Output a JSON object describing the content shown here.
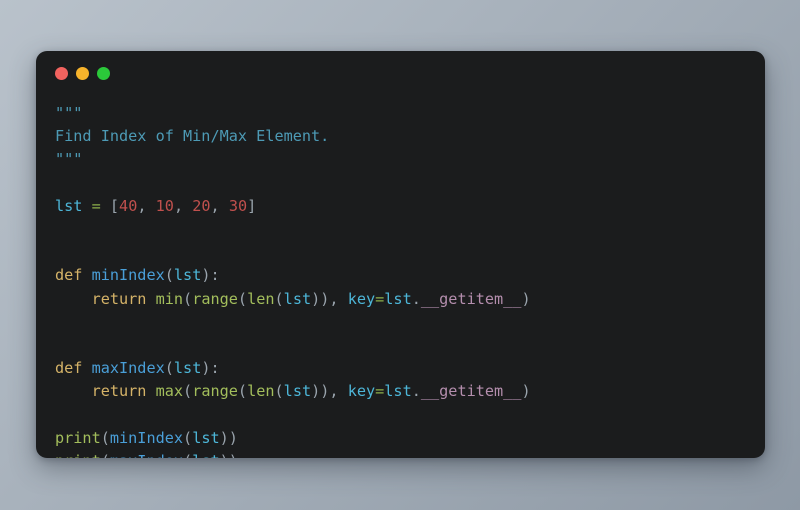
{
  "window": {
    "name": "code-snippet-window",
    "background": "#1b1c1d",
    "traffic_lights": [
      {
        "name": "close-button",
        "label": "close",
        "color": "#f2635f"
      },
      {
        "name": "minimize-button",
        "label": "minimize",
        "color": "#f7b32b"
      },
      {
        "name": "maximize-button",
        "label": "maximize",
        "color": "#2bc93a"
      }
    ]
  },
  "page": {
    "background_start": "#b9c2cb",
    "background_end": "#8e99a5"
  },
  "editor": {
    "language": "python",
    "font_size_px": 15,
    "plain_text": "\"\"\"\nFind Index of Min/Max Element.\n\"\"\"\n\nlst = [40, 10, 20, 30]\n\n\ndef minIndex(lst):\n    return min(range(len(lst)), key=lst.__getitem__)\n\n\ndef maxIndex(lst):\n    return max(range(len(lst)), key=lst.__getitem__)\n\nprint(minIndex(lst))\nprint(maxIndex(lst))",
    "palette": {
      "default": "#9aa4ad",
      "docstring": "#4d9ab5",
      "keyword": "#d5b368",
      "function": "#4a9fd8",
      "variable": "#4db6d8",
      "builtin": "#a3be5c",
      "operator": "#8cae4a",
      "number": "#c0504d",
      "dunder": "#b48ead",
      "punct": "#9aa4ad"
    },
    "lines": [
      {
        "tokens": [
          {
            "t": "\"\"\"",
            "c": "docstring"
          }
        ]
      },
      {
        "tokens": [
          {
            "t": "Find Index of Min/Max Element.",
            "c": "docstring"
          }
        ]
      },
      {
        "tokens": [
          {
            "t": "\"\"\"",
            "c": "docstring"
          }
        ]
      },
      {
        "tokens": []
      },
      {
        "tokens": [
          {
            "t": "lst",
            "c": "variable"
          },
          {
            "t": " ",
            "c": "punct"
          },
          {
            "t": "=",
            "c": "operator"
          },
          {
            "t": " [",
            "c": "punct"
          },
          {
            "t": "40",
            "c": "number"
          },
          {
            "t": ", ",
            "c": "punct"
          },
          {
            "t": "10",
            "c": "number"
          },
          {
            "t": ", ",
            "c": "punct"
          },
          {
            "t": "20",
            "c": "number"
          },
          {
            "t": ", ",
            "c": "punct"
          },
          {
            "t": "30",
            "c": "number"
          },
          {
            "t": "]",
            "c": "punct"
          }
        ]
      },
      {
        "tokens": []
      },
      {
        "tokens": []
      },
      {
        "tokens": [
          {
            "t": "def",
            "c": "keyword"
          },
          {
            "t": " ",
            "c": "punct"
          },
          {
            "t": "minIndex",
            "c": "function"
          },
          {
            "t": "(",
            "c": "punct"
          },
          {
            "t": "lst",
            "c": "variable"
          },
          {
            "t": "):",
            "c": "punct"
          }
        ]
      },
      {
        "tokens": [
          {
            "t": "    ",
            "c": "punct"
          },
          {
            "t": "return",
            "c": "keyword"
          },
          {
            "t": " ",
            "c": "punct"
          },
          {
            "t": "min",
            "c": "builtin"
          },
          {
            "t": "(",
            "c": "punct"
          },
          {
            "t": "range",
            "c": "builtin"
          },
          {
            "t": "(",
            "c": "punct"
          },
          {
            "t": "len",
            "c": "builtin"
          },
          {
            "t": "(",
            "c": "punct"
          },
          {
            "t": "lst",
            "c": "variable"
          },
          {
            "t": ")), ",
            "c": "punct"
          },
          {
            "t": "key",
            "c": "variable"
          },
          {
            "t": "=",
            "c": "operator"
          },
          {
            "t": "lst",
            "c": "variable"
          },
          {
            "t": ".",
            "c": "punct"
          },
          {
            "t": "__getitem__",
            "c": "dunder"
          },
          {
            "t": ")",
            "c": "punct"
          }
        ]
      },
      {
        "tokens": []
      },
      {
        "tokens": []
      },
      {
        "tokens": [
          {
            "t": "def",
            "c": "keyword"
          },
          {
            "t": " ",
            "c": "punct"
          },
          {
            "t": "maxIndex",
            "c": "function"
          },
          {
            "t": "(",
            "c": "punct"
          },
          {
            "t": "lst",
            "c": "variable"
          },
          {
            "t": "):",
            "c": "punct"
          }
        ]
      },
      {
        "tokens": [
          {
            "t": "    ",
            "c": "punct"
          },
          {
            "t": "return",
            "c": "keyword"
          },
          {
            "t": " ",
            "c": "punct"
          },
          {
            "t": "max",
            "c": "builtin"
          },
          {
            "t": "(",
            "c": "punct"
          },
          {
            "t": "range",
            "c": "builtin"
          },
          {
            "t": "(",
            "c": "punct"
          },
          {
            "t": "len",
            "c": "builtin"
          },
          {
            "t": "(",
            "c": "punct"
          },
          {
            "t": "lst",
            "c": "variable"
          },
          {
            "t": ")), ",
            "c": "punct"
          },
          {
            "t": "key",
            "c": "variable"
          },
          {
            "t": "=",
            "c": "operator"
          },
          {
            "t": "lst",
            "c": "variable"
          },
          {
            "t": ".",
            "c": "punct"
          },
          {
            "t": "__getitem__",
            "c": "dunder"
          },
          {
            "t": ")",
            "c": "punct"
          }
        ]
      },
      {
        "tokens": []
      },
      {
        "tokens": [
          {
            "t": "print",
            "c": "builtin"
          },
          {
            "t": "(",
            "c": "punct"
          },
          {
            "t": "minIndex",
            "c": "function"
          },
          {
            "t": "(",
            "c": "punct"
          },
          {
            "t": "lst",
            "c": "variable"
          },
          {
            "t": "))",
            "c": "punct"
          }
        ]
      },
      {
        "tokens": [
          {
            "t": "print",
            "c": "builtin"
          },
          {
            "t": "(",
            "c": "punct"
          },
          {
            "t": "maxIndex",
            "c": "function"
          },
          {
            "t": "(",
            "c": "punct"
          },
          {
            "t": "lst",
            "c": "variable"
          },
          {
            "t": "))",
            "c": "punct"
          }
        ]
      }
    ]
  }
}
